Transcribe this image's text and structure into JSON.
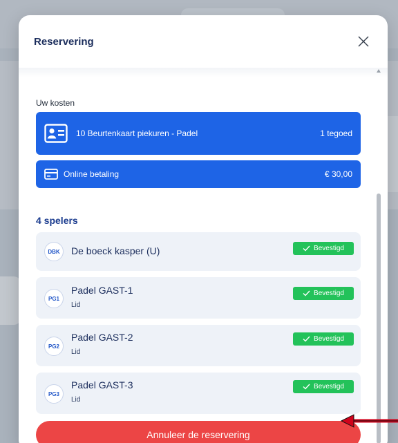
{
  "modal": {
    "title": "Reservering",
    "costs_label": "Uw kosten",
    "cost_items": [
      {
        "label": "10 Beurtenkaart piekuren - Padel",
        "amount": "1 tegoed",
        "icon": "id-card-icon"
      },
      {
        "label": "Online betaling",
        "amount": "€ 30,00",
        "icon": "credit-card-icon"
      }
    ],
    "players_title": "4 spelers",
    "players": [
      {
        "initials": "DBK",
        "name": "De boeck kasper (U)",
        "role": "",
        "status": "Bevestigd"
      },
      {
        "initials": "PG1",
        "name": "Padel GAST-1",
        "role": "Lid",
        "status": "Bevestigd"
      },
      {
        "initials": "PG2",
        "name": "Padel GAST-2",
        "role": "Lid",
        "status": "Bevestigd"
      },
      {
        "initials": "PG3",
        "name": "Padel GAST-3",
        "role": "Lid",
        "status": "Bevestigd"
      }
    ],
    "cancel_label": "Annuleer de reservering"
  },
  "colors": {
    "primary": "#1e64e6",
    "title": "#1b2d5c",
    "confirmed": "#23c25a",
    "danger": "#ec4545",
    "annotation_arrow": "#d0021b"
  }
}
